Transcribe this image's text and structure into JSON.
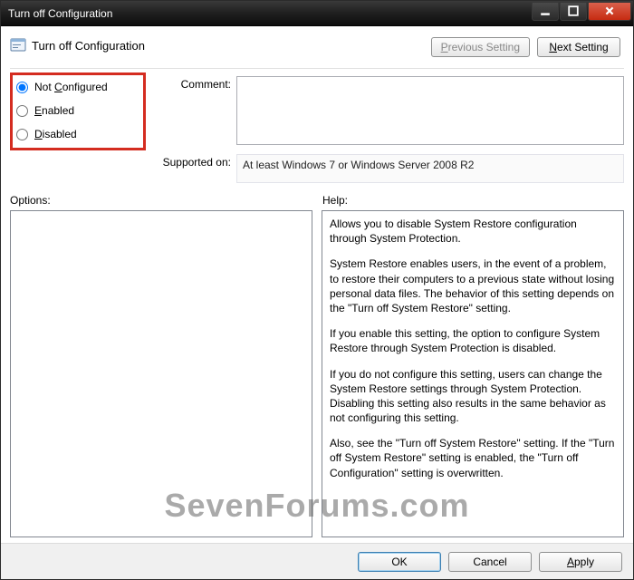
{
  "window": {
    "title": "Turn off Configuration"
  },
  "header": {
    "policy_title": "Turn off Configuration"
  },
  "nav": {
    "previous": "Previous Setting",
    "next": "Next Setting"
  },
  "state": {
    "not_configured": "Not Configured",
    "enabled": "Enabled",
    "disabled": "Disabled",
    "selected": "not_configured"
  },
  "labels": {
    "comment": "Comment:",
    "supported_on": "Supported on:",
    "options": "Options:",
    "help": "Help:"
  },
  "comment": "",
  "supported_on": "At least Windows 7 or Windows Server 2008 R2",
  "options": "",
  "help": [
    "Allows you to disable System Restore configuration through System Protection.",
    "System Restore enables users, in the event of a problem, to restore their computers to a previous state without losing personal data files. The behavior of this setting depends on the \"Turn off System Restore\" setting.",
    "If you enable this setting, the option to configure System Restore through System Protection is disabled.",
    "If you do not configure this setting, users can change the System Restore settings through System Protection. Disabling this setting also results in the same behavior as not configuring this setting.",
    "Also, see the \"Turn off System Restore\" setting. If the \"Turn off System Restore\" setting is enabled, the \"Turn off Configuration\" setting is overwritten."
  ],
  "buttons": {
    "ok": "OK",
    "cancel": "Cancel",
    "apply": "Apply"
  },
  "watermark": "SevenForums.com"
}
